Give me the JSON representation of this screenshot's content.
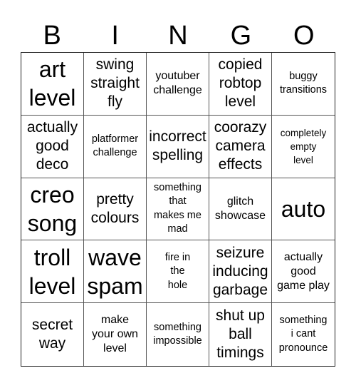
{
  "title_letters": [
    "B",
    "I",
    "N",
    "G",
    "O"
  ],
  "cells": [
    {
      "text": "art level",
      "size": "xl"
    },
    {
      "text": "swing straight fly",
      "size": "l"
    },
    {
      "text": "youtuber challenge",
      "size": "m"
    },
    {
      "text": "copied robtop level",
      "size": "l"
    },
    {
      "text": "buggy transitions",
      "size": "s"
    },
    {
      "text": "actually good deco",
      "size": "l"
    },
    {
      "text": "platformer challenge",
      "size": "s"
    },
    {
      "text": "incorrect spelling",
      "size": "l"
    },
    {
      "text": "coorazy camera effects",
      "size": "l"
    },
    {
      "text": "completely empty level",
      "size": "xs"
    },
    {
      "text": "creo song",
      "size": "xl"
    },
    {
      "text": "pretty colours",
      "size": "l"
    },
    {
      "text": "something that makes me mad",
      "size": "s"
    },
    {
      "text": "glitch showcase",
      "size": "m"
    },
    {
      "text": "auto",
      "size": "xl"
    },
    {
      "text": "troll level",
      "size": "xl"
    },
    {
      "text": "wave spam",
      "size": "xl"
    },
    {
      "text": "fire in the hole",
      "size": "s"
    },
    {
      "text": "seizure inducing garbage",
      "size": "l"
    },
    {
      "text": "actually good game play",
      "size": "m"
    },
    {
      "text": "secret way",
      "size": "l"
    },
    {
      "text": "make your own level",
      "size": "m"
    },
    {
      "text": "something impossible",
      "size": "s"
    },
    {
      "text": "shut up ball timings",
      "size": "l"
    },
    {
      "text": "something i cant pronounce",
      "size": "s"
    }
  ]
}
